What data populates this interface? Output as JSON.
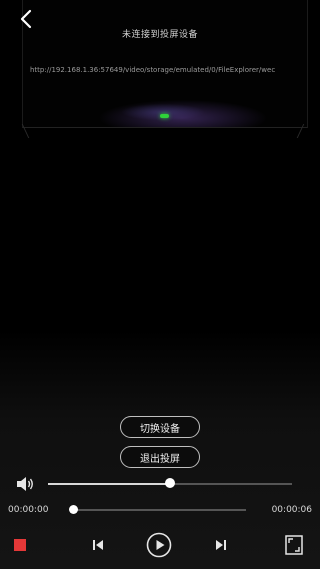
{
  "header": {
    "back_icon": "chevron-left-icon",
    "status": "未连接到投屏设备",
    "url": "http://192.168.1.36:57649/video/storage/emulated/0/FileExplorer/wec"
  },
  "colors": {
    "accent_led": "#2fd33a",
    "stop": "#e53838",
    "background": "#000000"
  },
  "buttons": {
    "switch_device": "切换设备",
    "exit_cast": "退出投屏"
  },
  "volume": {
    "icon": "speaker-icon",
    "level": 0.5
  },
  "progress": {
    "current_time": "00:00:00",
    "total_time": "00:00:06",
    "fraction": 0
  },
  "controls": {
    "stop_icon": "stop-icon",
    "prev_icon": "skip-previous-icon",
    "play_icon": "play-circle-icon",
    "next_icon": "skip-next-icon",
    "fullscreen_icon": "fullscreen-icon"
  }
}
